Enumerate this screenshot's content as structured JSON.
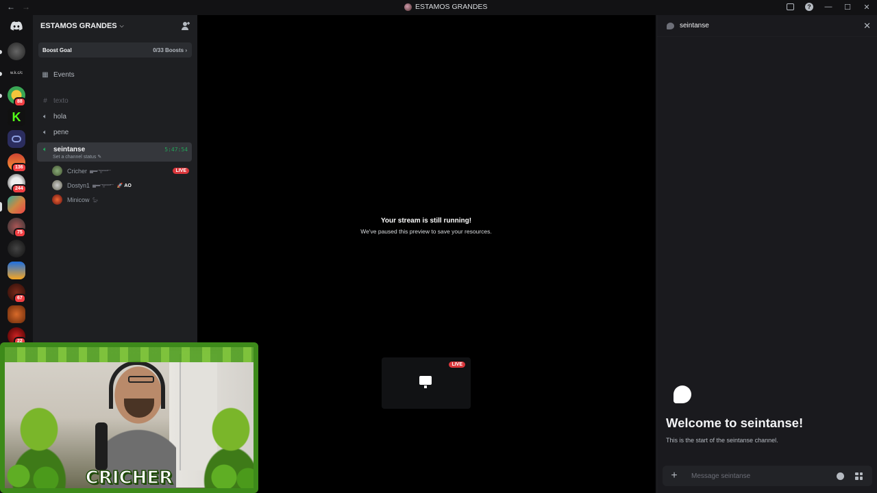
{
  "titlebar": {
    "back_icon": "arrow-left-icon",
    "forward_icon": "arrow-right-icon",
    "title": "ESTAMOS GRANDES",
    "controls": [
      "inbox-icon",
      "help-icon",
      "minimize-icon",
      "maximize-icon",
      "close-icon"
    ]
  },
  "rail": {
    "home_icon": "discord-logo-icon",
    "text_server_label": "w.k.c/c",
    "badges": [
      "88",
      "136",
      "244",
      "75",
      "67",
      "22"
    ]
  },
  "server": {
    "name": "ESTAMOS GRANDES",
    "boost_goal_label": "Boost Goal",
    "boost_progress": "0/33 Boosts",
    "events_label": "Events",
    "channels": [
      {
        "name": "texto",
        "type": "text"
      },
      {
        "name": "hola",
        "type": "voice"
      },
      {
        "name": "pene",
        "type": "voice"
      },
      {
        "name": "seintanse",
        "type": "voice",
        "active": true,
        "timer": "5:47:54",
        "status": "Set a channel status"
      }
    ],
    "voice_users": [
      {
        "name": "Cricher",
        "live": "LIVE"
      },
      {
        "name": "Dostyn1",
        "tag": "AO"
      },
      {
        "name": "Minicow"
      }
    ]
  },
  "stage": {
    "title": "Your stream is still running!",
    "subtitle": "We've paused this preview to save your resources.",
    "tile_live": "LIVE"
  },
  "chat": {
    "channel": "seintanse",
    "welcome_title": "Welcome to seintanse!",
    "welcome_sub": "This is the start of the seintanse channel.",
    "input_placeholder": "Message seintanse"
  },
  "webcam": {
    "overlay_name": "CRICHER"
  },
  "colors": {
    "live": "#da373c",
    "voice_active": "#23a55a",
    "badge": "#f23f43",
    "overlay_frame": "#3d8a1a"
  }
}
